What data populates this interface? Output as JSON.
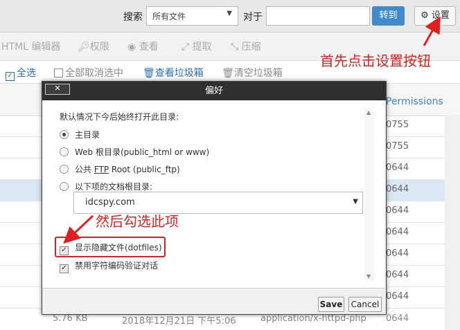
{
  "topbar": {
    "search_label": "搜索",
    "scope_value": "所有文件",
    "for_label": "对于",
    "search_value": "",
    "goto_label": "转到",
    "settings_label": "设置"
  },
  "toolbar": {
    "items": [
      "HTML 编辑器",
      "权限",
      "查看",
      "提取",
      "压缩"
    ]
  },
  "actions": {
    "select_all": "全选",
    "deselect_all": "全部取消选中",
    "view_trash": "查看垃圾箱",
    "empty_trash": "清空垃圾箱"
  },
  "table": {
    "perm_header": "Permissions",
    "perms": [
      "0755",
      "0755",
      "0644",
      "0644",
      "0644",
      "0644",
      "0644",
      "0644",
      "0644"
    ],
    "last_row": {
      "size": "5.76 KB",
      "date": "2018年12月21日 下午5:06",
      "type": "application/x-httpd-php",
      "perm": "0644"
    }
  },
  "dialog": {
    "title": "偏好",
    "close_label": "✕",
    "prompt": "默认情况下今后始终打开此目录:",
    "options": [
      "主目录",
      "Web 根目录(public_html or www)",
      "公共 FTP Root (public_ftp)",
      "以下项的文档根目录:"
    ],
    "selected_option": 0,
    "dir_value": "idcspy.com",
    "show_hidden_label": "显示隐藏文件(dotfiles)",
    "show_hidden_checked": true,
    "disable_charset_label": "禁用字符编码验证对话",
    "disable_charset_checked": true,
    "save_label": "Save",
    "cancel_label": "Cancel"
  },
  "annotations": {
    "first": "首先点击设置按钮",
    "then": "然后勾选此项",
    "color": "#e02020"
  }
}
